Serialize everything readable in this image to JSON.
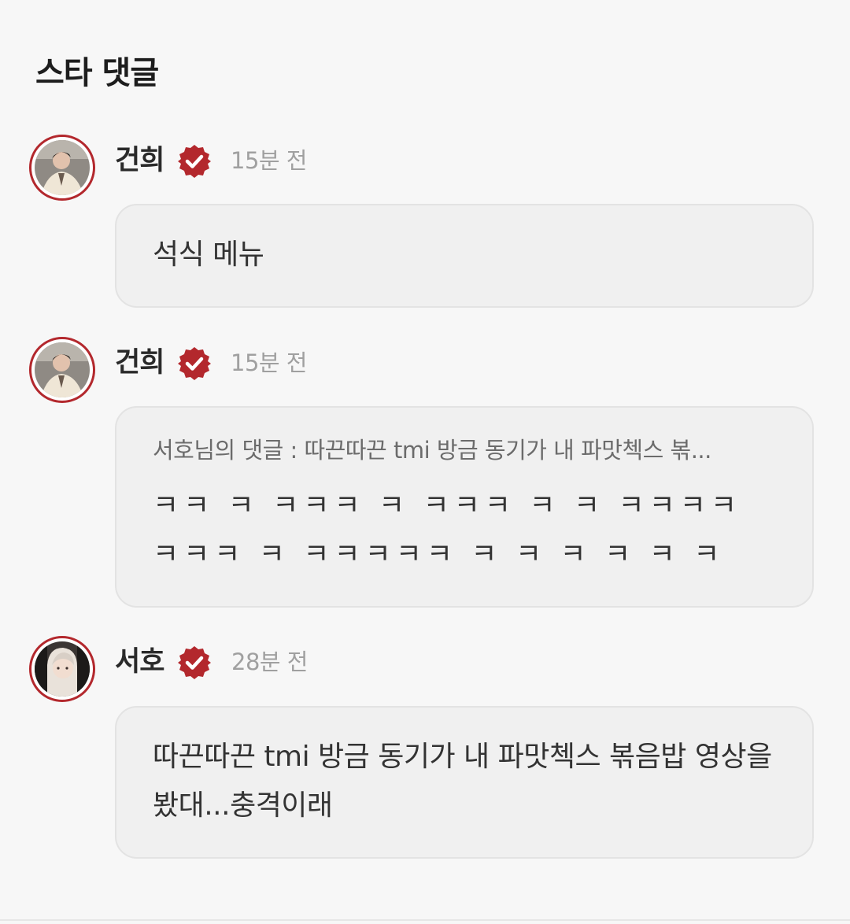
{
  "header": {
    "title": "스타 댓글"
  },
  "colors": {
    "accent": "#b3282d",
    "background": "#f7f7f7",
    "bubble": "#f0f0f0",
    "muted_text": "#a0a0a0"
  },
  "comments": [
    {
      "author": "건희",
      "verified_icon": "verified-badge-icon",
      "time": "15분 전",
      "text": "석식 메뉴"
    },
    {
      "author": "건희",
      "verified_icon": "verified-badge-icon",
      "time": "15분 전",
      "quote": "서호님의 댓글 : 따끈따끈 tmi 방금 동기가 내 파맛첵스 볶...",
      "text": "ㅋㅋ ㅋ ㅋㅋㅋ ㅋ ㅋㅋㅋ ㅋ ㅋ ㅋㅋㅋㅋ ㅋㅋㅋ ㅋ ㅋㅋㅋㅋㅋ ㅋ ㅋ ㅋ ㅋ ㅋ ㅋ"
    },
    {
      "author": "서호",
      "verified_icon": "verified-badge-icon",
      "time": "28분 전",
      "text": "따끈따끈 tmi 방금 동기가 내 파맛첵스 볶음밥 영상을 봤대...충격이래"
    }
  ]
}
